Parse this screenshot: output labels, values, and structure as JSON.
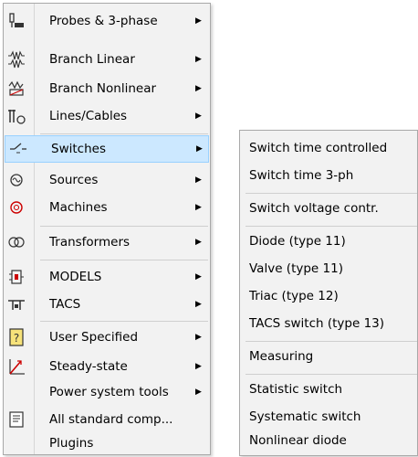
{
  "main_menu": {
    "items": [
      {
        "label": "Probes & 3-phase",
        "icon": "probe-icon",
        "has_submenu": true
      },
      {
        "label": "Branch Linear",
        "icon": "resistor-icon",
        "has_submenu": true
      },
      {
        "label": "Branch Nonlinear",
        "icon": "nonlinear-icon",
        "has_submenu": true
      },
      {
        "label": "Lines/Cables",
        "icon": "lines-icon",
        "has_submenu": true
      },
      {
        "label": "Switches",
        "icon": "switch-icon",
        "has_submenu": true,
        "highlighted": true
      },
      {
        "label": "Sources",
        "icon": "source-icon",
        "has_submenu": true
      },
      {
        "label": "Machines",
        "icon": "machine-icon",
        "has_submenu": true
      },
      {
        "label": "Transformers",
        "icon": "transformer-icon",
        "has_submenu": true
      },
      {
        "label": "MODELS",
        "icon": "models-icon",
        "has_submenu": true
      },
      {
        "label": "TACS",
        "icon": "tacs-icon",
        "has_submenu": true
      },
      {
        "label": "User Specified",
        "icon": "user-specified-icon",
        "has_submenu": true
      },
      {
        "label": "Steady-state",
        "icon": "steady-state-icon",
        "has_submenu": true
      },
      {
        "label": "Power system tools",
        "icon": "",
        "has_submenu": true
      },
      {
        "label": "All standard comp...",
        "icon": "all-components-icon",
        "has_submenu": false
      },
      {
        "label": "Plugins",
        "icon": "",
        "has_submenu": false
      }
    ]
  },
  "submenu": {
    "items": [
      {
        "label": "Switch time controlled"
      },
      {
        "label": "Switch time 3-ph"
      },
      {
        "label": "Switch voltage contr."
      },
      {
        "label": "Diode (type 11)"
      },
      {
        "label": "Valve (type 11)"
      },
      {
        "label": "Triac (type 12)"
      },
      {
        "label": "TACS switch (type 13)"
      },
      {
        "label": "Measuring"
      },
      {
        "label": "Statistic switch"
      },
      {
        "label": "Systematic switch"
      },
      {
        "label": "Nonlinear diode"
      }
    ]
  },
  "arrow_glyph": "▶"
}
